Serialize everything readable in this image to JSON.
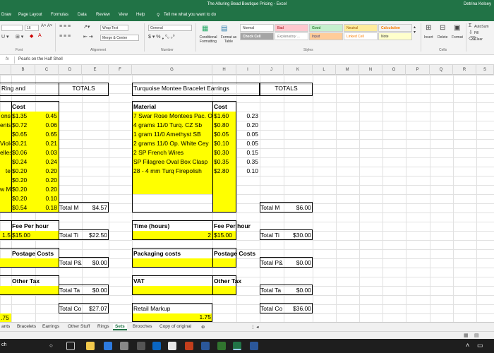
{
  "window": {
    "title": "The Alluring Bead Boutique Pricing  -  Excel",
    "user": "Detrina Kelsey"
  },
  "menu": [
    "Draw",
    "Page Layout",
    "Formulas",
    "Data",
    "Review",
    "View",
    "Help",
    "Tell me what you want to do"
  ],
  "ribbon": {
    "font_size": "16",
    "wrap_text": "Wrap Text",
    "merge_center": "Merge & Center",
    "number_format": "General",
    "cond_format": "Conditional Formatting",
    "format_table": "Format as Table",
    "styles": [
      "Normal",
      "Bad",
      "Good",
      "Neutral",
      "Calculation",
      "Check Cell",
      "Explanatory ...",
      "Input",
      "Linked Cell",
      "Note"
    ],
    "cells": [
      "Insert",
      "Delete",
      "Format"
    ],
    "autosum": "AutoSum",
    "fill": "Fill",
    "clear": "Clear",
    "groups": [
      "Font",
      "Alignment",
      "Number",
      "Styles",
      "Cells"
    ]
  },
  "formula_bar": {
    "fx": "fx",
    "value": "Pearls on the Half Shell"
  },
  "columns": [
    "B",
    "C",
    "D",
    "E",
    "F",
    "G",
    "H",
    "I",
    "J",
    "K",
    "L",
    "M",
    "N",
    "O",
    "P",
    "Q",
    "R",
    "S"
  ],
  "left_block": {
    "heading": "Ring and",
    "totals_heading": "TOTALS",
    "cost_header": "Cost",
    "labels": [
      "ons",
      "ents",
      "",
      "Viole",
      "elles",
      "",
      "te",
      "",
      "w M",
      "",
      ""
    ],
    "costs": [
      "$1.35",
      "$0.72",
      "$0.65",
      "$0.21",
      "$0.06",
      "$0.24",
      "$0.20",
      "$0.20",
      "$0.20",
      "$0.20",
      "$0.54"
    ],
    "qtys": [
      "0.45",
      "0.06",
      "0.65",
      "0.21",
      "0.03",
      "0.24",
      "0.20",
      "0.20",
      "0.20",
      "0.10",
      "0.18"
    ],
    "total_m_label": "Total M",
    "total_m_value": "$4.57",
    "fee_header": "Fee Per hour",
    "hours": "1.5",
    "fee": "$15.00",
    "total_ti_label": "Total Ti",
    "total_ti_value": "$22.50",
    "postage_header": "Postage Costs",
    "total_p_label": "Total P&",
    "total_p_value": "$0.00",
    "other_tax_header": "Other Tax",
    "total_ta_label": "Total Ta",
    "total_ta_value": "$0.00",
    "total_co_label": "Total Co",
    "total_co_value": "$27.07",
    "markup": ".75"
  },
  "right_block": {
    "heading": "Turquoise Montee Bracelet Earrings",
    "totals_heading": "TOTALS",
    "material_header": "Material",
    "cost_header": "Cost",
    "materials": [
      "7 Swar Rose Montees Pac. O",
      "4 grams 11/0 Turq. CZ Sb",
      "1 gram 11/0 Amethyst SB",
      "2 grams 11/0 Op. White Cey",
      "2 SP French Wires",
      "SP Filagree Oval Box Clasp",
      "28 - 4 mm Turq Firepolish"
    ],
    "costs": [
      "$1.60",
      "$0.80",
      "$0.05",
      "$0.10",
      "$0.30",
      "$0.35",
      "$2.80"
    ],
    "qtys": [
      "0.23",
      "0.20",
      "0.05",
      "0.05",
      "0.15",
      "0.35",
      "0.10"
    ],
    "total_m_label": "Total M",
    "total_m_value": "$6.00",
    "time_header": "Time (hours)",
    "fee_header": "Fee Per hour",
    "hours": "2",
    "fee": "$15.00",
    "total_ti_label": "Total Ti",
    "total_ti_value": "$30.00",
    "packaging_header": "Packaging costs",
    "postage_header": "Postage Costs",
    "total_p_label": "Total P&",
    "total_p_value": "$0.00",
    "vat_header": "VAT",
    "other_tax_header": "Other Tax",
    "total_ta_label": "Total Ta",
    "total_ta_value": "$0.00",
    "markup_header": "Retail Markup",
    "markup": "1.75",
    "total_co_label": "Total Co",
    "total_co_value": "$36.00"
  },
  "sheet_tabs": [
    "ants",
    "Bracelets",
    "Earrings",
    "Other Stuff",
    "Rings",
    "Sets",
    "Brooches",
    "Copy of original"
  ],
  "active_tab": "Sets",
  "taskbar": {
    "search_text": "ch"
  }
}
